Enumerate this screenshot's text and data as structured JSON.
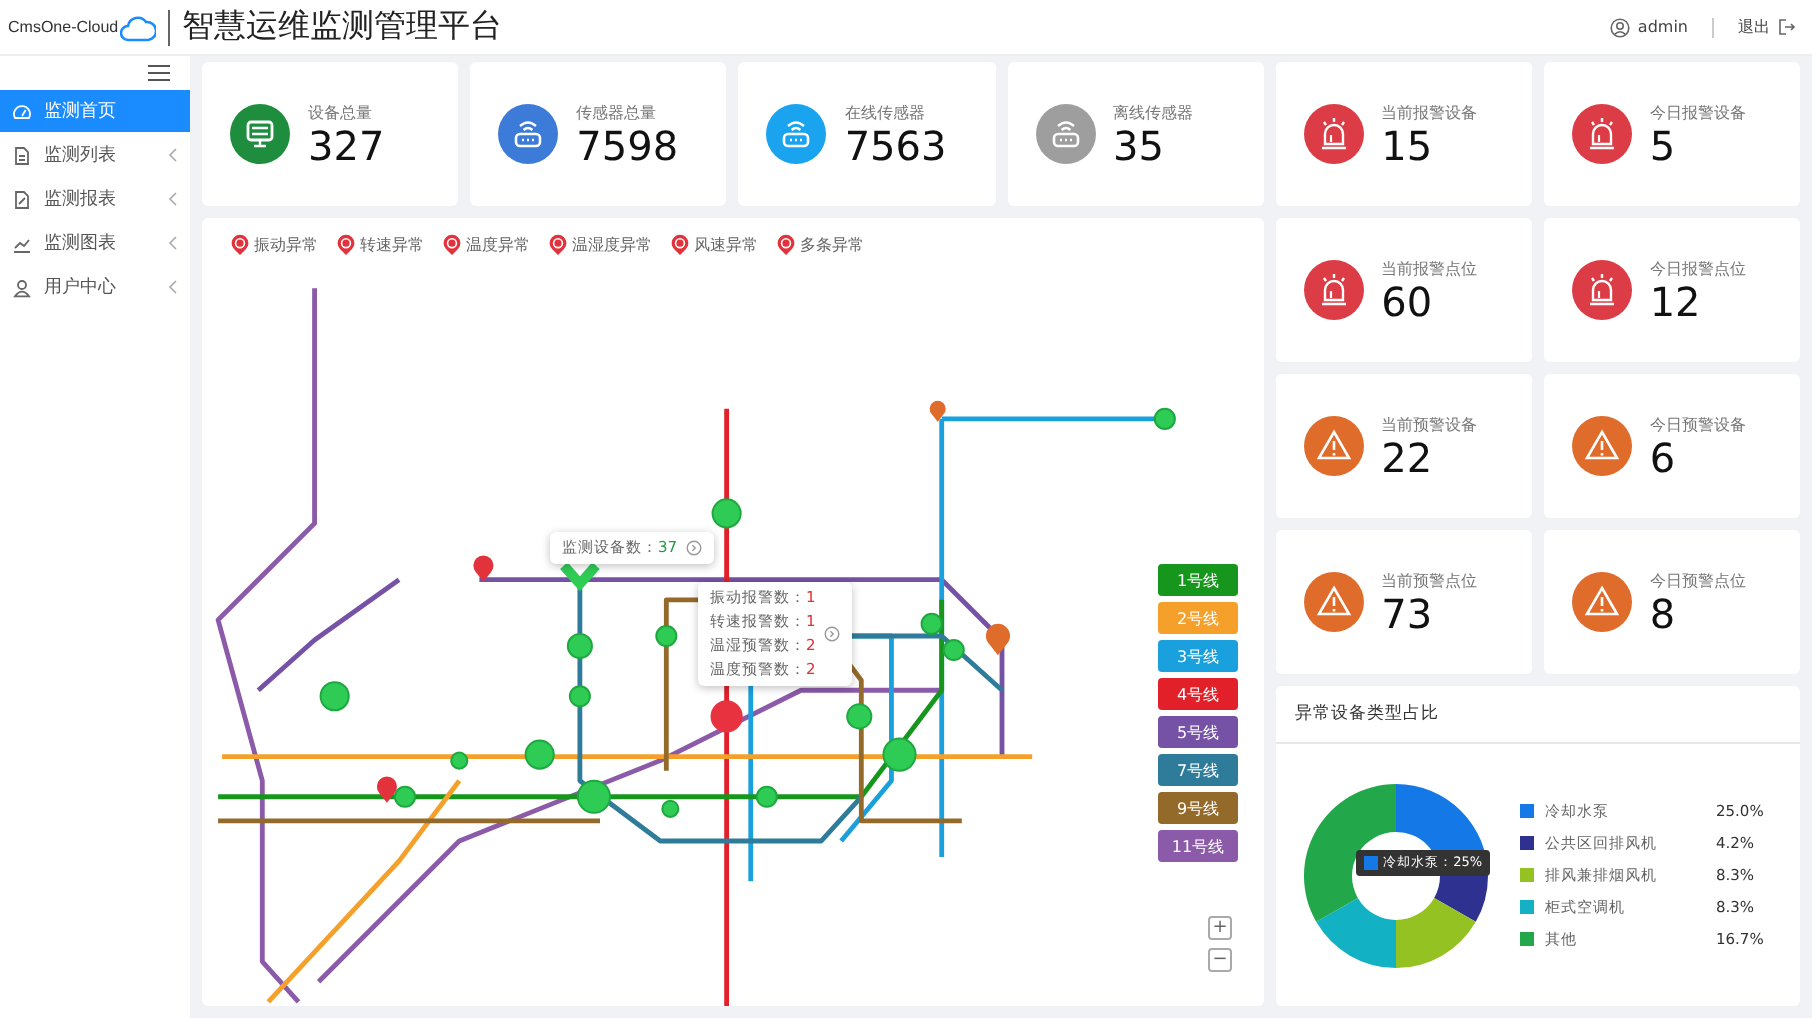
{
  "header": {
    "logo_text": "CmsOne-Cloud",
    "title": "智慧运维监测管理平台",
    "user": "admin",
    "logout": "退出"
  },
  "sidebar": {
    "items": [
      {
        "label": "监测首页",
        "selected": true,
        "has_submenu": false
      },
      {
        "label": "监测列表",
        "selected": false,
        "has_submenu": true
      },
      {
        "label": "监测报表",
        "selected": false,
        "has_submenu": true
      },
      {
        "label": "监测图表",
        "selected": false,
        "has_submenu": true
      },
      {
        "label": "用户中心",
        "selected": false,
        "has_submenu": true
      }
    ]
  },
  "stats": [
    {
      "label": "设备总量",
      "value": "327",
      "kind": "device",
      "color": "#1e8e3e"
    },
    {
      "label": "传感器总量",
      "value": "7598",
      "kind": "sensor",
      "color": "#3d7bd9"
    },
    {
      "label": "在线传感器",
      "value": "7563",
      "kind": "sensor",
      "color": "#1aa3ef"
    },
    {
      "label": "离线传感器",
      "value": "35",
      "kind": "sensor",
      "color": "#9e9e9e"
    },
    {
      "label": "当前报警设备",
      "value": "15",
      "kind": "alarm",
      "color": "#dc3c45"
    },
    {
      "label": "今日报警设备",
      "value": "5",
      "kind": "alarm",
      "color": "#dc3c45"
    },
    {
      "label": "当前报警点位",
      "value": "60",
      "kind": "alarm",
      "color": "#dc3c45"
    },
    {
      "label": "今日报警点位",
      "value": "12",
      "kind": "alarm",
      "color": "#dc3c45"
    },
    {
      "label": "当前预警设备",
      "value": "22",
      "kind": "warning",
      "color": "#e06c2c"
    },
    {
      "label": "今日预警设备",
      "value": "6",
      "kind": "warning",
      "color": "#e06c2c"
    },
    {
      "label": "当前预警点位",
      "value": "73",
      "kind": "warning",
      "color": "#e06c2c"
    },
    {
      "label": "今日预警点位",
      "value": "8",
      "kind": "warning",
      "color": "#e06c2c"
    }
  ],
  "map": {
    "legend": [
      {
        "label": "振动异常"
      },
      {
        "label": "转速异常"
      },
      {
        "label": "温度异常"
      },
      {
        "label": "温湿度异常"
      },
      {
        "label": "风速异常"
      },
      {
        "label": "多条异常"
      }
    ],
    "device_tooltip": {
      "label": "监测设备数：",
      "value": "37"
    },
    "alarm_tooltip": [
      "振动报警数：",
      "转速报警数：",
      "温湿预警数：",
      "温度预警数："
    ],
    "alarm_tooltip_values": [
      "1",
      "1",
      "2",
      "2"
    ],
    "lines": [
      {
        "label": "1号线",
        "color": "#16961c"
      },
      {
        "label": "2号线",
        "color": "#f5a02a"
      },
      {
        "label": "3号线",
        "color": "#1aa0dc"
      },
      {
        "label": "4号线",
        "color": "#e2202a"
      },
      {
        "label": "5号线",
        "color": "#7552a5"
      },
      {
        "label": "7号线",
        "color": "#2e7c9a"
      },
      {
        "label": "9号线",
        "color": "#936a2a"
      },
      {
        "label": "11号线",
        "color": "#8b5aa8"
      }
    ],
    "zoom_in": "+",
    "zoom_out": "−"
  },
  "donut": {
    "title": "异常设备类型占比",
    "chart_data": {
      "type": "donut",
      "categories": [
        "冷却水泵",
        "公共区回排风机",
        "排风兼排烟风机",
        "柜式空调机",
        "其他"
      ],
      "series": [
        {
          "values": [
            25.0,
            8.3,
            16.7,
            16.7,
            33.3
          ]
        }
      ]
    },
    "legend": [
      {
        "percent": "25.0%",
        "color": "#1479e6"
      },
      {
        "percent": "4.2%",
        "color": "#2f3190"
      },
      {
        "percent": "8.3%",
        "color": "#95c223"
      },
      {
        "percent": "8.3%",
        "color": "#12b2c4"
      },
      {
        "percent": "16.7%",
        "color": "#22a84a"
      }
    ],
    "tooltip": "冷却水泵：25%"
  }
}
